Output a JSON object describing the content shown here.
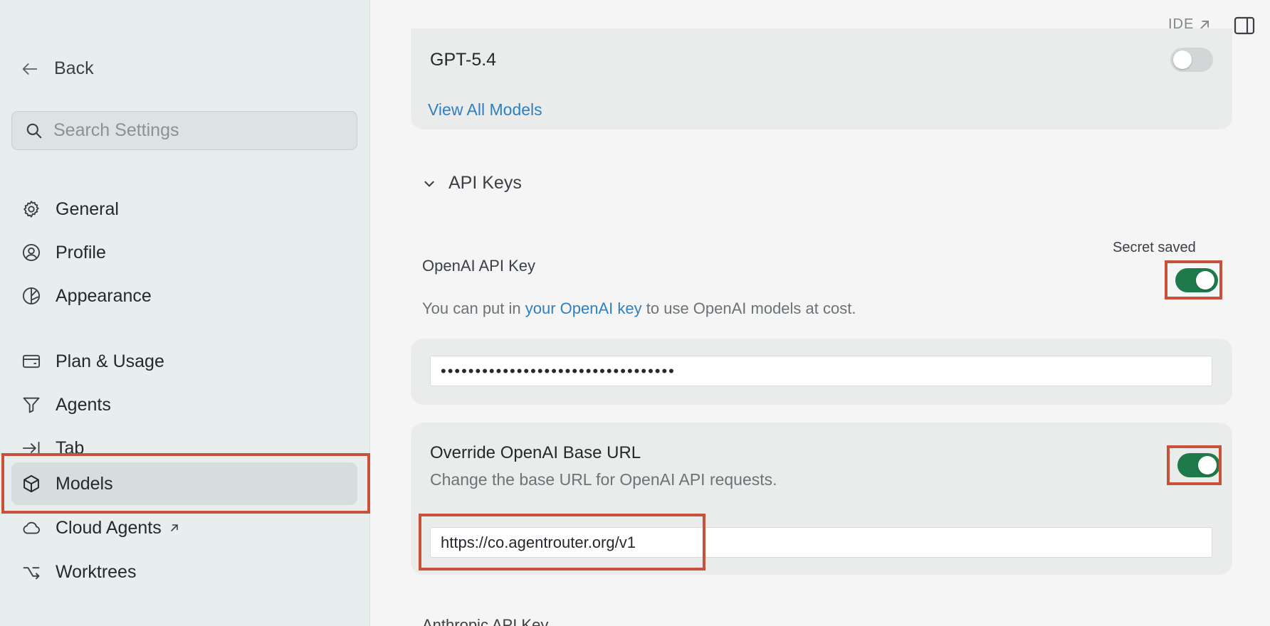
{
  "sidebar": {
    "back_label": "Back",
    "search_placeholder": "Search Settings",
    "items": [
      {
        "label": "General",
        "icon": "gear-icon"
      },
      {
        "label": "Profile",
        "icon": "user-circle-icon"
      },
      {
        "label": "Appearance",
        "icon": "contrast-icon"
      },
      {
        "label": "Plan & Usage",
        "icon": "card-icon"
      },
      {
        "label": "Agents",
        "icon": "filter-icon"
      },
      {
        "label": "Tab",
        "icon": "arrow-to-line-icon"
      },
      {
        "label": "Models",
        "icon": "cube-icon",
        "active": true
      },
      {
        "label": "Cloud Agents",
        "icon": "cloud-icon",
        "external": true
      },
      {
        "label": "Worktrees",
        "icon": "branch-icon"
      }
    ]
  },
  "header": {
    "ide_label": "IDE"
  },
  "models": {
    "model_name": "GPT-5.4",
    "model_enabled": false,
    "view_all_label": "View All Models"
  },
  "api_keys": {
    "section_label": "API Keys",
    "openai": {
      "secret_status": "Secret saved",
      "label": "OpenAI API Key",
      "enabled": true,
      "desc_prefix": "You can put in ",
      "desc_link": "your OpenAI key",
      "desc_suffix": " to use OpenAI models at cost.",
      "masked_value": "••••••••••••••••••••••••••••••••••"
    },
    "override": {
      "title": "Override OpenAI Base URL",
      "description": "Change the base URL for OpenAI API requests.",
      "enabled": true,
      "url_value": "https://co.agentrouter.org/v1"
    },
    "next_label": "Anthropic API Key"
  },
  "colors": {
    "accent_link": "#2f7fc1",
    "toggle_on": "#1e7a4a",
    "highlight_box": "#c9513a"
  }
}
